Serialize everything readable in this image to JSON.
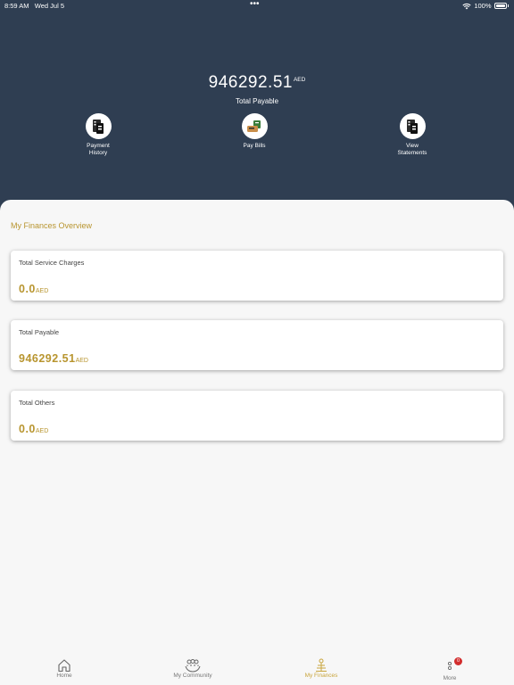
{
  "status_bar": {
    "time": "8:59 AM",
    "date": "Wed Jul 5",
    "dots": "•••",
    "battery": "100%"
  },
  "summary": {
    "amount": "946292.51",
    "currency": "AED",
    "label": "Total Payable"
  },
  "actions": [
    {
      "label_line1": "Payment",
      "label_line2": "History",
      "icon": "payment-history-icon"
    },
    {
      "label_line1": "Pay Bills",
      "label_line2": "",
      "icon": "pay-bills-icon"
    },
    {
      "label_line1": "View",
      "label_line2": "Statements",
      "icon": "view-statements-icon"
    }
  ],
  "overview": {
    "title": "My Finances Overview",
    "cards": [
      {
        "title": "Total Service Charges",
        "amount": "0.0",
        "currency": "AED"
      },
      {
        "title": "Total Payable",
        "amount": "946292.51",
        "currency": "AED"
      },
      {
        "title": "Total Others",
        "amount": "0.0",
        "currency": "AED"
      }
    ]
  },
  "tabs": [
    {
      "label": "Home",
      "icon": "home-icon"
    },
    {
      "label": "My Community",
      "icon": "community-icon"
    },
    {
      "label": "My Finances",
      "icon": "finances-icon"
    },
    {
      "label": "More",
      "icon": "more-icon",
      "badge": "0"
    }
  ],
  "colors": {
    "header": "#2f3e52",
    "accent": "#b8952f",
    "active_tab": "#c9a53d",
    "badge": "#d22d2d"
  }
}
